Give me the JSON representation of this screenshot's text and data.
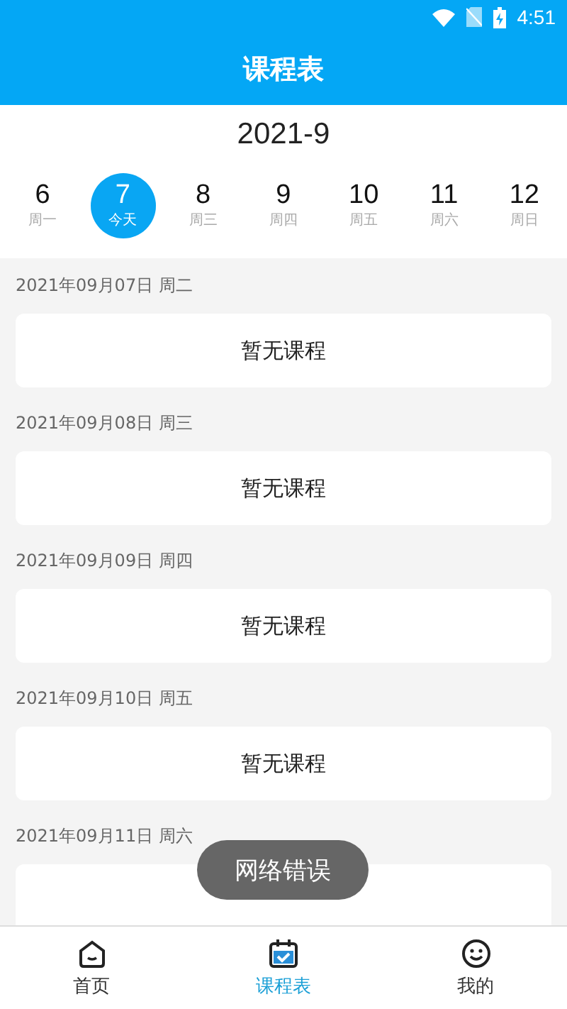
{
  "status_bar": {
    "time": "4:51"
  },
  "header": {
    "title": "课程表"
  },
  "month": "2021-9",
  "days": [
    {
      "number": "6",
      "label": "周一",
      "selected": false
    },
    {
      "number": "7",
      "label": "今天",
      "selected": true
    },
    {
      "number": "8",
      "label": "周三",
      "selected": false
    },
    {
      "number": "9",
      "label": "周四",
      "selected": false
    },
    {
      "number": "10",
      "label": "周五",
      "selected": false
    },
    {
      "number": "11",
      "label": "周六",
      "selected": false
    },
    {
      "number": "12",
      "label": "周日",
      "selected": false
    }
  ],
  "sections": [
    {
      "date": "2021年09月07日 周二",
      "message": "暂无课程"
    },
    {
      "date": "2021年09月08日 周三",
      "message": "暂无课程"
    },
    {
      "date": "2021年09月09日 周四",
      "message": "暂无课程"
    },
    {
      "date": "2021年09月10日 周五",
      "message": "暂无课程"
    },
    {
      "date": "2021年09月11日 周六"
    }
  ],
  "toast": "网络错误",
  "tab_bar": [
    {
      "kind": "home",
      "label": "首页",
      "selected": false
    },
    {
      "kind": "schedule",
      "label": "课程表",
      "selected": true
    },
    {
      "kind": "mine",
      "label": "我的",
      "selected": false
    }
  ]
}
